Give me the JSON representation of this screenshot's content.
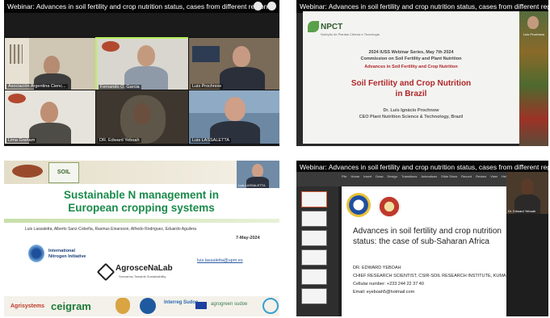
{
  "panel1": {
    "title": "Webinar: Advances in soil fertility and crop nutrition status, cases from different regions",
    "tiles": [
      {
        "name": "Asociación Argentina Cienc..."
      },
      {
        "name": "Fernando O. Garcia"
      },
      {
        "name": "Luis Prochnow"
      },
      {
        "name": "Lima Graham"
      },
      {
        "name": "DR. Edward Yeboah"
      },
      {
        "name": "Luis LASSALETTA"
      }
    ]
  },
  "panel2": {
    "title": "Webinar: Advances in soil fertility and crop nutrition status, cases from different regions",
    "logo": "NPCT",
    "logo_sub": "Nutrição de Plantas Ciência e Tecnologia",
    "series": "2024 IUSS Webinar Series, May 7th 2024",
    "commission": "Commission on Soil Fertility and Plant Nutrition",
    "subtitle": "Advances in Soil Fertility and Crop Nutrition",
    "main_title_1": "Soil Fertility and Crop Nutrition",
    "main_title_2": "in Brazil",
    "author": "Dr. Luís Ignácio Prochnow",
    "affiliation": "CEO Plant Nutrition Science & Technology, Brazil",
    "side_name": "Luis Prochnow"
  },
  "panel3": {
    "soil_logo": "SOIL",
    "speaker": "Luis LASSALETTA",
    "title_1": "Sustainable N management in",
    "title_2": "European cropping systems",
    "authors": "Luis Lassaletta, Alberto Sanz-Cobeña, Rasmus Einarsson, Alfredo Rodriguez, Eduardo Aguilera",
    "date": "7-May-2024",
    "email": "luis.lassaletta@upm.es",
    "ini_1": "International",
    "ini_2": "Nitrogen Initiative",
    "agrosce": "AgrosceNaLab",
    "agrosce_sub": "Scenarios Towards Sustainability",
    "footer": [
      "Agrisystems",
      "ceigram",
      "Interreg Sudoe",
      "agrogreen sudoe"
    ]
  },
  "panel4": {
    "title": "Webinar: Advances in soil fertility and crop nutrition status, cases from different regions",
    "cam_name": "Dr. Edward Yeboah",
    "title_1": "Advances in soil fertility and crop nutrition",
    "title_2": "status: the case of sub-Saharan Africa",
    "name": "DR. EDWARD YEBOAH",
    "position": "CHIEF RESEARCH SCIENTIST, CSIR-SOIL RESEARCH INSTITUTE, KUMASI",
    "phone": "Cellular number: +233 244 22 37 40",
    "email": "Email: eyeboah5@hotmail.com",
    "ribbon_tabs": [
      "File",
      "Home",
      "Insert",
      "Draw",
      "Design",
      "Transitions",
      "Animations",
      "Slide Show",
      "Record",
      "Review",
      "View",
      "Help"
    ]
  },
  "colors": {
    "title_green": "#1a8a4a",
    "slide_red": "#b0262a",
    "npct_green": "#2e5b2f"
  }
}
